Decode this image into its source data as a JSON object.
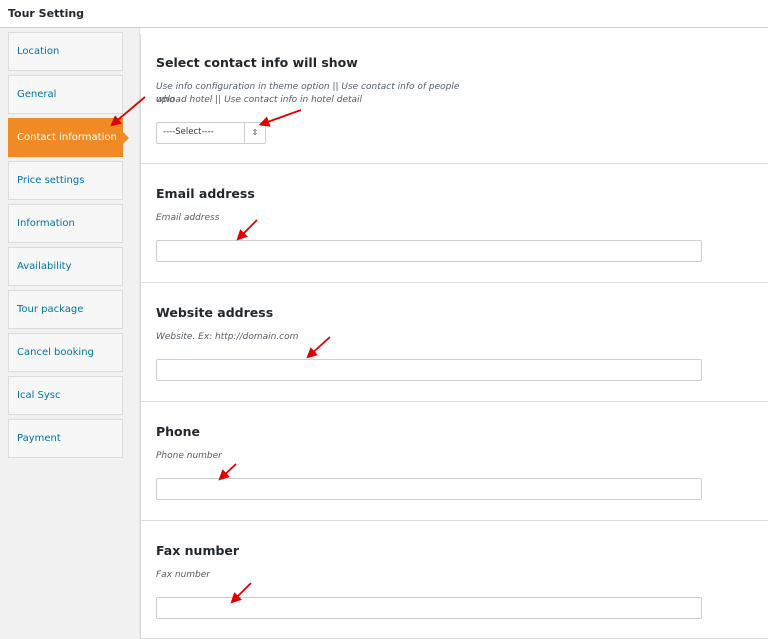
{
  "header": {
    "title": "Tour Setting"
  },
  "sidebar": {
    "items": [
      {
        "label": "Location"
      },
      {
        "label": "General"
      },
      {
        "label": "Contact information"
      },
      {
        "label": "Price settings"
      },
      {
        "label": "Information"
      },
      {
        "label": "Availability"
      },
      {
        "label": "Tour package"
      },
      {
        "label": "Cancel booking"
      },
      {
        "label": "Ical Sysc"
      },
      {
        "label": "Payment"
      }
    ],
    "active_index": 2
  },
  "sections": {
    "contact": {
      "title": "Select contact info will show",
      "desc_line1": "Use info configuration in theme option || Use contact info of people who",
      "desc_line2": "upload hotel || Use contact info in hotel detail",
      "select_value": "----Select----",
      "select_arrow_icon": "updown-arrows-icon"
    },
    "email": {
      "title": "Email address",
      "desc": "Email address",
      "value": ""
    },
    "website": {
      "title": "Website address",
      "desc": "Website. Ex: http://domain.com",
      "value": ""
    },
    "phone": {
      "title": "Phone",
      "desc": "Phone number",
      "value": ""
    },
    "fax": {
      "title": "Fax number",
      "desc": "Fax number",
      "value": ""
    }
  },
  "colors": {
    "active_tab": "#f08a24",
    "annotation_arrow": "#e00000",
    "link": "#0073aa"
  }
}
